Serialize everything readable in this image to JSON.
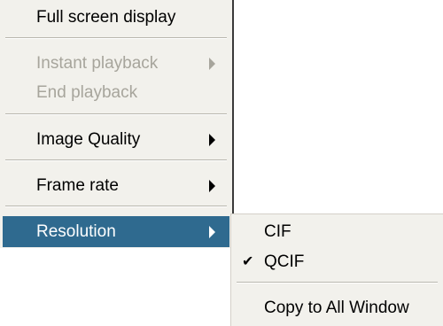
{
  "main_menu": {
    "items": [
      {
        "label": "Full screen display",
        "enabled": true
      },
      {
        "label": "Instant playback",
        "enabled": false,
        "has_submenu": true
      },
      {
        "label": "End playback",
        "enabled": false
      },
      {
        "label": "Image Quality",
        "enabled": true,
        "has_submenu": true
      },
      {
        "label": "Frame rate",
        "enabled": true,
        "has_submenu": true
      },
      {
        "label": "Resolution",
        "enabled": true,
        "has_submenu": true,
        "highlighted": true
      }
    ]
  },
  "submenu": {
    "items": [
      {
        "label": "CIF",
        "checked": false
      },
      {
        "label": "QCIF",
        "checked": true,
        "check_glyph": "✔"
      },
      {
        "label": "Copy to All Window",
        "checked": false
      }
    ]
  },
  "colors": {
    "menu_background": "#f2f1ec",
    "highlight": "#2f6a8f",
    "disabled_text": "#a7a59c"
  }
}
